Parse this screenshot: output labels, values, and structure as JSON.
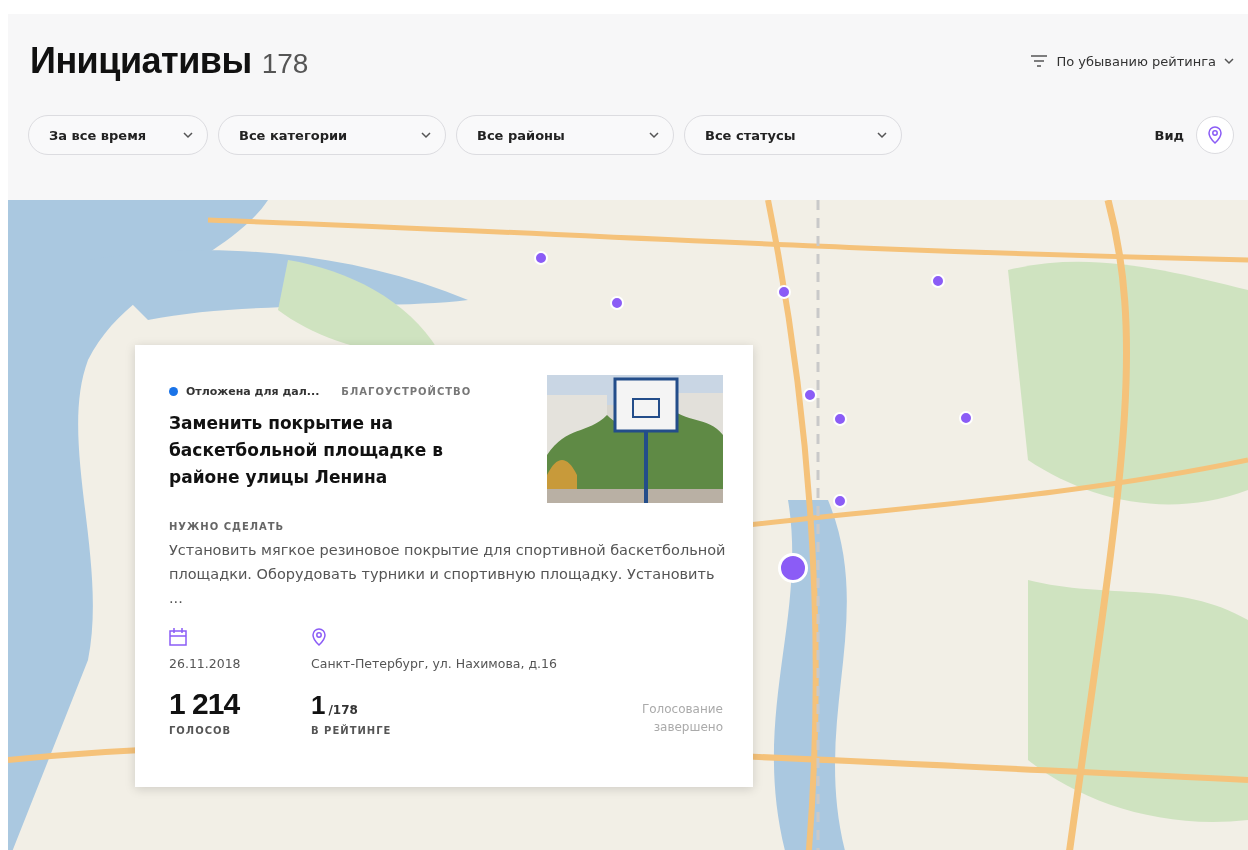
{
  "header": {
    "title": "Инициативы",
    "count": "178",
    "sort": {
      "label": "По убыванию рейтинга"
    }
  },
  "filters": [
    {
      "label": "За все время"
    },
    {
      "label": "Все категории"
    },
    {
      "label": "Все районы"
    },
    {
      "label": "Все статусы"
    }
  ],
  "view": {
    "label": "Вид"
  },
  "card": {
    "status": {
      "label": "Отложена для дал...",
      "color": "#1a73e8"
    },
    "category": "БЛАГОУСТРОЙСТВО",
    "title": "Заменить покрытие на баскетбольной площадке в районе улицы Ленина",
    "section_label": "НУЖНО СДЕЛАТЬ",
    "description": "Установить мягкое резиновое покрытие для спортивной баскетбольной площадки. Оборудовать турники и спортивную площадку. Установить ...",
    "date": "26.11.2018",
    "address": "Санкт-Петербург, ул. Нахимова, д.16",
    "votes": "1 214",
    "votes_label": "ГОЛОСОВ",
    "rank": "1",
    "rank_total": "/178",
    "rank_label": "В РЕЙТИНГЕ",
    "voting_status": "Голосование завершено"
  }
}
